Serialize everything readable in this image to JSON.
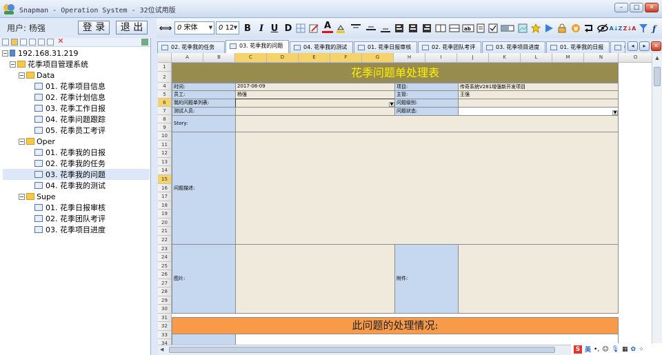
{
  "window": {
    "title": "Snapman - Operation System - 32位试用版",
    "buttons": [
      "–",
      "□",
      "✕"
    ]
  },
  "userbar": {
    "user_label": "用户: 杨强",
    "login_label": "登 录",
    "logout_label": "退 出"
  },
  "toolbar": {
    "font_name": "宋体",
    "font_size": "12",
    "bold": "B",
    "italic": "I",
    "underline": "U",
    "strike": "D",
    "font_color_glyph": "A",
    "sort_az": "A↓Z",
    "sort_za": "Z↓A"
  },
  "tree": {
    "root": "192.168.31.219",
    "system": "花季项目管理系统",
    "groups": [
      {
        "name": "Data",
        "items": [
          "01. 花季项目信息",
          "02. 花季计划信息",
          "03. 花季工作日报",
          "04. 花季问题跟踪",
          "05. 花季员工考评"
        ]
      },
      {
        "name": "Oper",
        "items": [
          "01. 花季我的日报",
          "02. 花季我的任务",
          "03. 花季我的问题",
          "04. 花季我的测试"
        ]
      },
      {
        "name": "Supe",
        "items": [
          "01. 花季日报审核",
          "02. 花季团队考评",
          "03. 花季项目进度"
        ]
      }
    ]
  },
  "tabs": [
    "02. 花季我的任务",
    "03. 花季我的问题",
    "04. 花季我的测试",
    "01. 花季日报审核",
    "02. 花季团队考评",
    "03. 花季项目进度",
    "01. 花季我的日报",
    "0"
  ],
  "active_tab": 1,
  "sheet": {
    "columns": [
      "A",
      "B",
      "C",
      "D",
      "E",
      "F",
      "G",
      "H",
      "I",
      "J",
      "K",
      "L",
      "M",
      "N",
      "O"
    ],
    "rows": [
      "1",
      "2",
      "4",
      "5",
      "6",
      "7",
      "8",
      "9",
      "10",
      "11",
      "12",
      "13",
      "14",
      "15",
      "16",
      "17",
      "18",
      "19",
      "20",
      "21",
      "22",
      "23",
      "24",
      "25",
      "26",
      "27",
      "28",
      "29",
      "30",
      "31",
      "32",
      "33",
      "34"
    ],
    "form_title": "花季问题单处理表",
    "labels": {
      "time": "时间:",
      "project": "项目:",
      "employee": "员工:",
      "manager": "主管:",
      "my_issues": "我的问题单列表:",
      "issue_level": "问题级别:",
      "tester": "测试人员:",
      "issue_status": "问题状态:",
      "story": "Story:",
      "description": "问题描述:",
      "image": "图片:",
      "attachment": "附件:"
    },
    "values": {
      "time": "2017-08-09",
      "project": "传奇系统V281增强新开发项目",
      "employee": "杨强",
      "manager": "王强"
    },
    "section_title": "此问题的处理情况:",
    "colors": {
      "title_bg": "#978c4e",
      "title_fg": "#fff200",
      "section_bg": "#f89a48",
      "label_bg": "#c5d8ef",
      "value_bg": "#efeadb"
    }
  },
  "ime": {
    "text": "英"
  }
}
